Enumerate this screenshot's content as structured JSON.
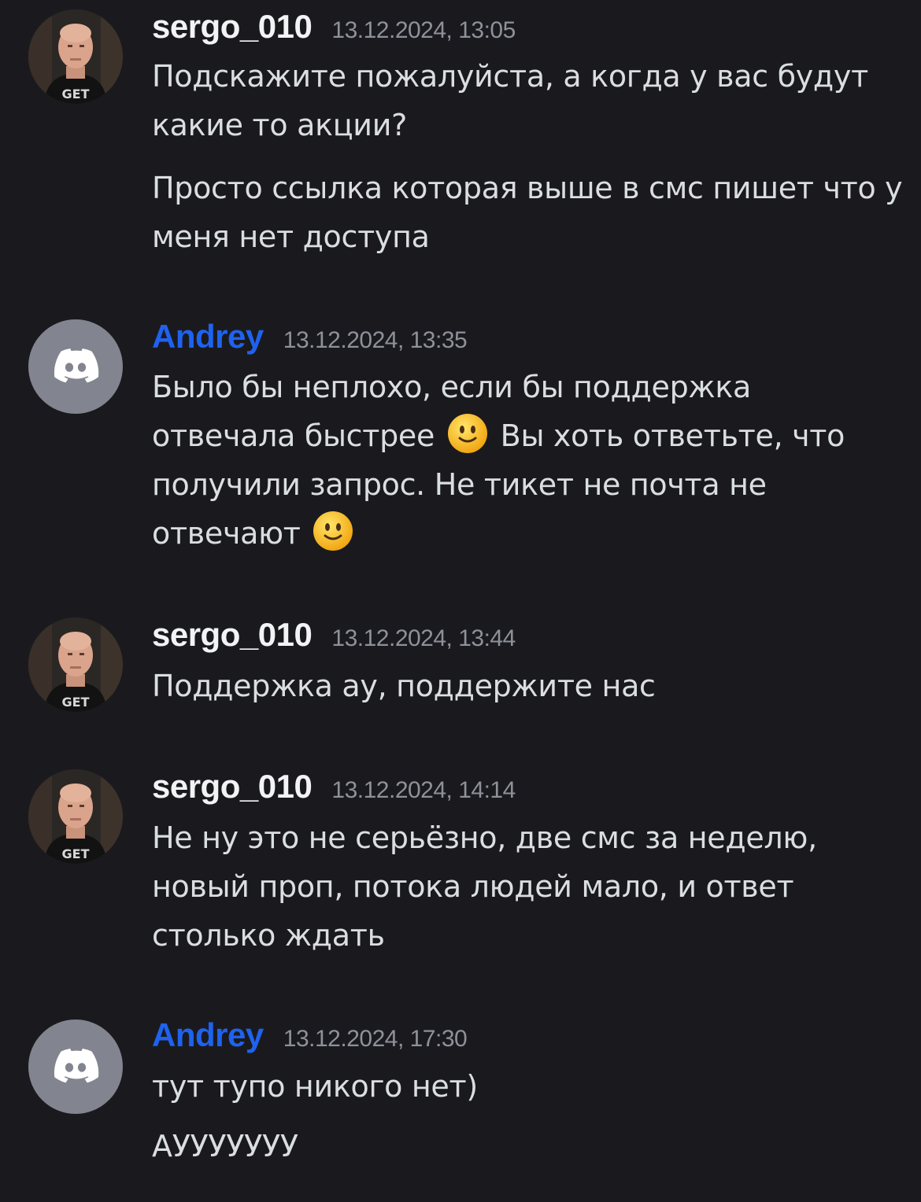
{
  "messages": [
    {
      "author": "sergo_010",
      "timestamp": "13.12.2024, 13:05",
      "avatar_icon": "user-photo-avatar",
      "lines": [
        "Подскажите пожалуйста, а когда у вас будут какие то акции?",
        "Просто ссылка которая выше в смс пишет что у меня нет доступа"
      ]
    },
    {
      "author": "Andrey",
      "timestamp": "13.12.2024, 13:35",
      "avatar_icon": "discord-logo-icon",
      "parts": {
        "a": "Было бы неплохо, если бы поддержка отвечала быстрее",
        "b": "Вы хоть ответьте, что получили запрос. Не тикет не почта не отвечают",
        "emoji": "slightly-smiling-face-icon"
      }
    },
    {
      "author": "sergo_010",
      "timestamp": "13.12.2024, 13:44",
      "avatar_icon": "user-photo-avatar",
      "lines": [
        "Поддержка ау, поддержите нас"
      ]
    },
    {
      "author": "sergo_010",
      "timestamp": "13.12.2024, 14:14",
      "avatar_icon": "user-photo-avatar",
      "lines": [
        "Не ну это не серьёзно, две смс за неделю, новый проп, потока людей мало, и ответ столько ждать"
      ]
    },
    {
      "author": "Andrey",
      "timestamp": "13.12.2024, 17:30",
      "avatar_icon": "discord-logo-icon",
      "lines": [
        "тут тупо никого нет)",
        "АУУУУУУУ"
      ]
    }
  ],
  "colors": {
    "background": "#1a1a1e",
    "andrey_name": "#1f62ef",
    "text": "#dbdee1",
    "timestamp": "#8e9199",
    "discord_avatar": "#82858f"
  }
}
